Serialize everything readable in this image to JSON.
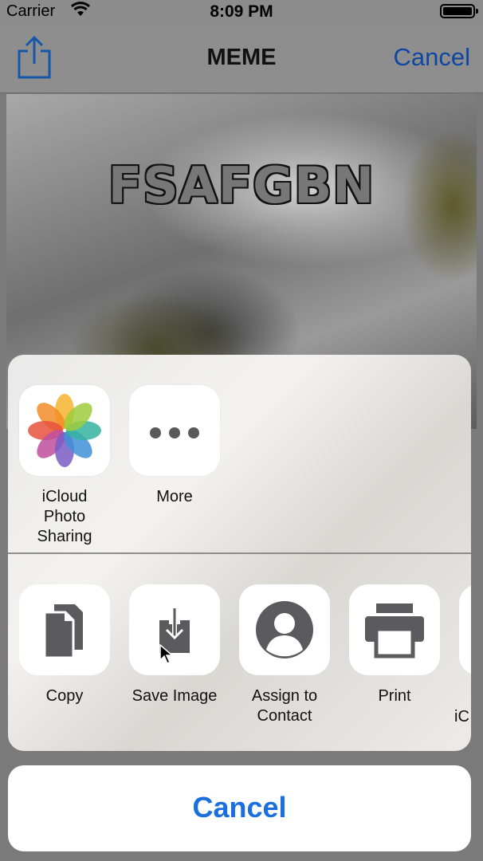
{
  "status_bar": {
    "carrier": "Carrier",
    "time": "8:09 PM"
  },
  "nav": {
    "title": "MEME",
    "cancel_label": "Cancel"
  },
  "meme": {
    "text": "FSAFGBN"
  },
  "share_sheet": {
    "apps": [
      {
        "label_line1": "iCloud Photo",
        "label_line2": "Sharing",
        "icon": "photos-icon"
      },
      {
        "label_line1": "More",
        "label_line2": "",
        "icon": "more-icon"
      }
    ],
    "actions": [
      {
        "label_line1": "Copy",
        "label_line2": "",
        "icon": "copy-icon"
      },
      {
        "label_line1": "Save Image",
        "label_line2": "",
        "icon": "save-image-icon"
      },
      {
        "label_line1": "Assign to",
        "label_line2": "Contact",
        "icon": "contact-icon"
      },
      {
        "label_line1": "Print",
        "label_line2": "",
        "icon": "print-icon"
      }
    ],
    "partial_action_label": "iC",
    "cancel_label": "Cancel"
  },
  "colors": {
    "accent": "#1a6fe0",
    "nav_accent": "#0d47a1"
  }
}
